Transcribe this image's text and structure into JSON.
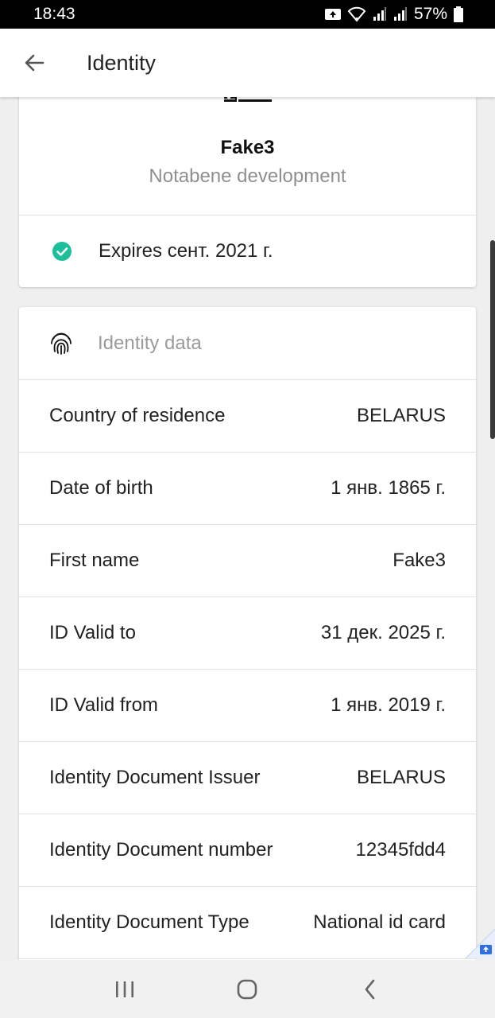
{
  "status_bar": {
    "time": "18:43",
    "battery": "57%"
  },
  "appbar": {
    "title": "Identity"
  },
  "document": {
    "name": "Fake3",
    "organization": "Notabene development",
    "expires": "Expires сент. 2021 г."
  },
  "identity_data": {
    "title": "Identity data",
    "rows": [
      {
        "label": "Country of residence",
        "value": "BELARUS"
      },
      {
        "label": "Date of birth",
        "value": "1 янв. 1865 г."
      },
      {
        "label": "First name",
        "value": "Fake3"
      },
      {
        "label": "ID Valid to",
        "value": "31 дек. 2025 г."
      },
      {
        "label": "ID Valid from",
        "value": "1 янв. 2019 г."
      },
      {
        "label": "Identity Document Issuer",
        "value": "BELARUS"
      },
      {
        "label": "Identity Document number",
        "value": "12345fdd4"
      },
      {
        "label": "Identity Document Type",
        "value": "National id card"
      },
      {
        "label": "",
        "value": ""
      }
    ]
  },
  "colors": {
    "accent_check": "#1dbf9a",
    "badge_blue": "#2f6fe0"
  }
}
